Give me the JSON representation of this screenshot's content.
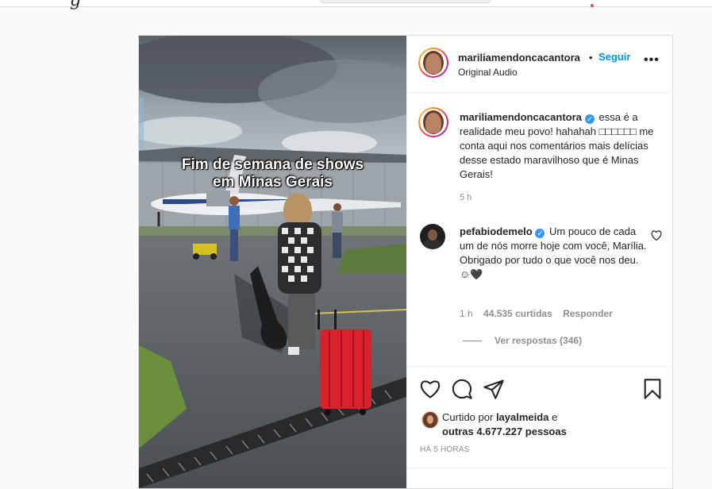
{
  "topbar": {
    "logo_fragment": "g"
  },
  "media": {
    "overlay_line1": "Fim de semana de shows",
    "overlay_line2": "em Minas Gerais"
  },
  "header": {
    "username": "mariliamendoncacantora",
    "separator": "•",
    "follow_label": "Seguir",
    "audio_label": "Original Audio",
    "more_label": "•••"
  },
  "caption": {
    "username": "mariliamendoncacantora",
    "text": "essa é a realidade meu povo! hahahah □□□□□□ me conta aqui nos comentários mais delícias desse estado maravilhoso que é Minas Gerais!",
    "time": "5 h"
  },
  "comment": {
    "username": "pefabiodemelo",
    "line1": "Um pouco de cada um de nós morre hoje com você, Marília.",
    "line2": "Obrigado por tudo o que você nos deu. ☺🖤",
    "time": "1 h",
    "likes": "44.535 curtidas",
    "reply_label": "Responder",
    "view_replies": "Ver respostas (346)"
  },
  "likes": {
    "prefix": "Curtido por",
    "user": "layalmeida",
    "middle": "e",
    "others": "outras 4.677.227 pessoas"
  },
  "posted_ago": "HÁ 5 HORAS",
  "icons": {
    "like": "heart-icon",
    "comment": "comment-icon",
    "share": "share-icon",
    "save": "bookmark-icon"
  },
  "colors": {
    "accent": "#0095f6",
    "verified": "#3897f0",
    "text": "#262626",
    "muted": "#8e8e8e",
    "suitcase": "#d8212b"
  }
}
